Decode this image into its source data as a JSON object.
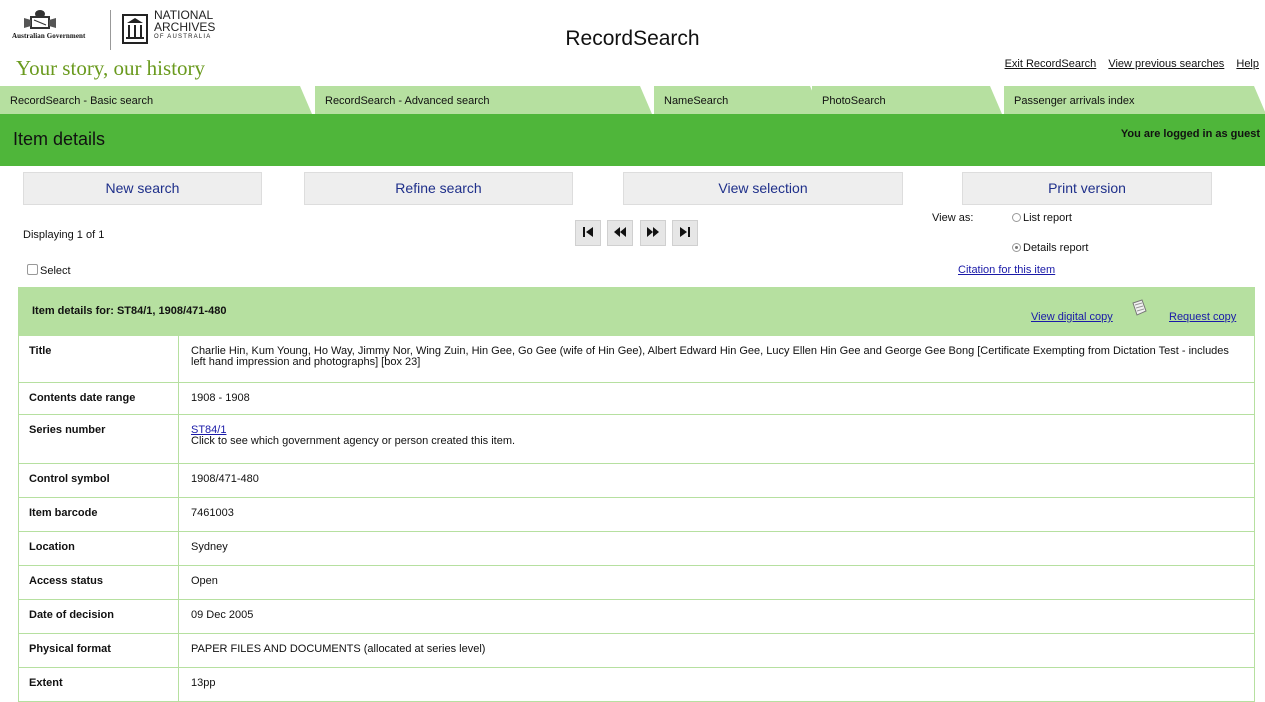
{
  "header": {
    "gov_name": "Australian Government",
    "naa_line1": "NATIONAL",
    "naa_line2": "ARCHIVES",
    "naa_line3": "OF AUSTRALIA",
    "tagline": "Your story, our history",
    "site_title": "RecordSearch",
    "links": [
      "Exit RecordSearch",
      "View previous searches",
      "Help"
    ]
  },
  "tabs": [
    "RecordSearch - Basic search",
    "RecordSearch - Advanced search",
    "NameSearch",
    "PhotoSearch",
    "Passenger arrivals index"
  ],
  "detail_bar": {
    "title": "Item details",
    "login_status": "You are logged in as guest"
  },
  "actions": [
    "New search",
    "Refine search",
    "View selection",
    "Print version"
  ],
  "navigation": {
    "displaying": "Displaying 1 of 1",
    "buttons": [
      "first-page-icon",
      "previous-page-icon",
      "next-page-icon",
      "last-page-icon"
    ],
    "view_as_label": "View as:",
    "view_options": [
      "List report",
      "Details report"
    ],
    "selected_view": "Details report",
    "select_label": "Select",
    "citation_link": "Citation for this item"
  },
  "item": {
    "header_label": "Item details for: ST84/1, 1908/471-480",
    "view_digital_copy": "View digital copy",
    "request_copy": "Request copy",
    "rows": [
      {
        "label": "Title",
        "value": "Charlie Hin, Kum Young, Ho Way, Jimmy Nor, Wing Zuin, Hin Gee, Go Gee (wife of Hin Gee), Albert Edward Hin Gee, Lucy Ellen Hin Gee and George Gee Bong [Certificate Exempting from Dictation Test - includes left hand impression and photographs] [box 23]"
      },
      {
        "label": "Contents date range",
        "value": "1908 - 1908"
      },
      {
        "label": "Series number",
        "link": "ST84/1",
        "value": "Click to see which government agency or person created this item."
      },
      {
        "label": "Control symbol",
        "value": "1908/471-480"
      },
      {
        "label": "Item barcode",
        "value": "7461003"
      },
      {
        "label": "Location",
        "value": "Sydney"
      },
      {
        "label": "Access status",
        "value": "Open"
      },
      {
        "label": "Date of decision",
        "value": "09 Dec 2005"
      },
      {
        "label": "Physical format",
        "value": "PAPER FILES AND DOCUMENTS (allocated at series level)"
      },
      {
        "label": "Extent",
        "value": "13pp"
      }
    ]
  },
  "colors": {
    "tab_green": "#b6e0a0",
    "bar_green": "#4fb63a",
    "tagline_green": "#6a9a1e",
    "link_blue": "#1a1aa8"
  }
}
